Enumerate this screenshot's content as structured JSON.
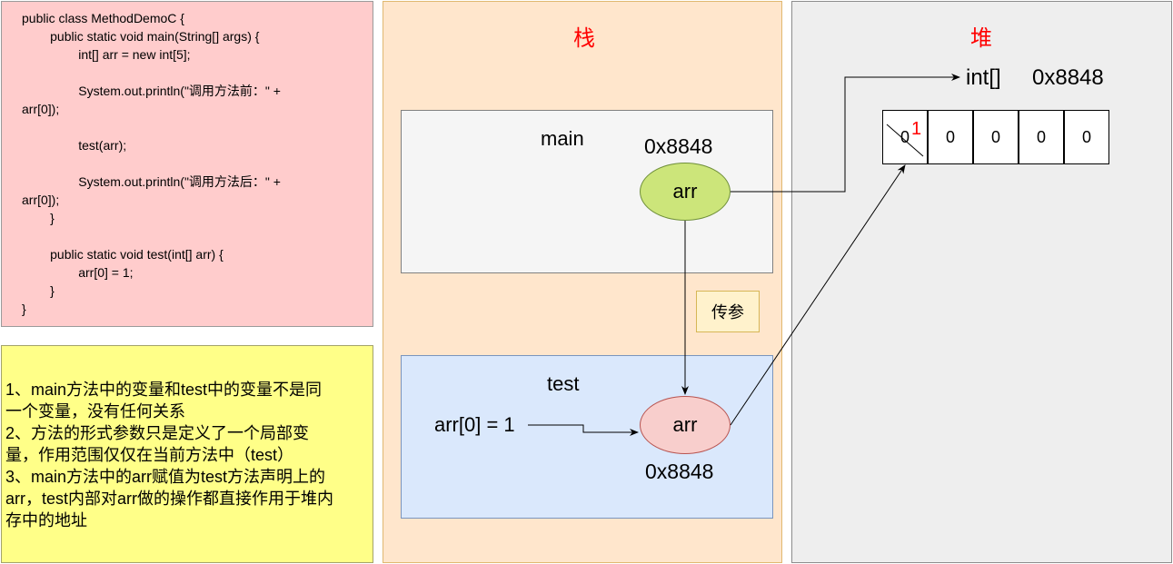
{
  "code": {
    "lines": [
      "public class MethodDemoC {",
      "        public static void main(String[] args) {",
      "                int[] arr = new int[5];",
      "",
      "                System.out.println(\"调用方法前：\" +",
      "arr[0]);",
      "",
      "                test(arr);",
      "",
      "                System.out.println(\"调用方法后：\" +",
      "arr[0]);",
      "        }",
      "",
      "        public static void test(int[] arr) {",
      "                arr[0] = 1;",
      "        }",
      "}"
    ]
  },
  "notes": {
    "lines": [
      "1、main方法中的变量和test中的变量不是同",
      "一个变量，没有任何关系",
      "2、方法的形式参数只是定义了一个局部变",
      "量，作用范围仅仅在当前方法中（test）",
      "3、main方法中的arr赋值为test方法声明上的",
      "arr，test内部对arr做的操作都直接作用于堆内",
      "存中的地址"
    ]
  },
  "stack": {
    "title": "栈",
    "main": {
      "label": "main",
      "address": "0x8848",
      "var": "arr"
    },
    "param_label": "传参",
    "test": {
      "label": "test",
      "address": "0x8848",
      "var": "arr",
      "assignment": "arr[0] = 1"
    }
  },
  "heap": {
    "title": "堆",
    "type_label": "int[]",
    "address": "0x8848",
    "cells": [
      "0",
      "0",
      "0",
      "0",
      "0"
    ],
    "cell0_new_value": "1"
  },
  "colors": {
    "code_bg": "#ffcccc",
    "notes_bg": "#ffff88",
    "stack_bg": "#ffe6cc",
    "heap_bg": "#eeeeee",
    "test_frame_bg": "#dae8fc",
    "main_var_bg": "#cce57a",
    "test_var_bg": "#f8cecc",
    "title_color": "#ff0000"
  }
}
